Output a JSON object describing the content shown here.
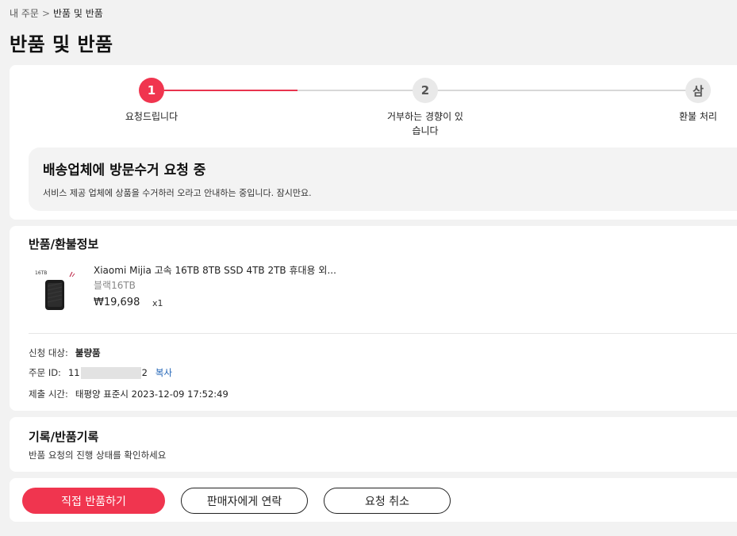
{
  "breadcrumb": {
    "parent": "내 주문",
    "separator": ">",
    "current": "반품 및 반품"
  },
  "page_title": "반품 및 반품",
  "steps": [
    {
      "number": "1",
      "label": "요청드립니다",
      "state": "active"
    },
    {
      "number": "2",
      "label_line1": "거부하는 경향이 있",
      "label_line2": "습니다",
      "state": "inactive"
    },
    {
      "number": "삼",
      "label": "환불 처리",
      "state": "inactive"
    }
  ],
  "notice": {
    "title": "배송업체에 방문수거 요청 중",
    "description": "서비스 제공 업체에 상품을 수거하러 오라고 안내하는 중입니다. 잠시만요."
  },
  "return_info": {
    "title": "반품/환불정보",
    "product": {
      "image_text": "16TB",
      "name": "Xiaomi Mijia 고속 16TB 8TB SSD 4TB 2TB 휴대용 외...",
      "variant": "블랙16TB",
      "price": "₩19,698",
      "quantity": "x1"
    },
    "request_target_label": "신청 대상:",
    "request_target_value": "불량품",
    "order_id_label": "주문 ID:",
    "order_id_prefix": "11",
    "order_id_suffix": "2",
    "copy_label": "복사",
    "submit_time_label": "제출 시간:",
    "submit_time_value": "태평양 표준시 2023-12-09 17:52:49"
  },
  "history": {
    "title": "기록/반품기록",
    "description": "반품 요청의 진행 상태를 확인하세요"
  },
  "actions": {
    "primary": "직접 반품하기",
    "contact": "판매자에게 연락",
    "cancel": "요청 취소"
  },
  "colors": {
    "accent": "#f0354f",
    "link": "#1a5fb4"
  }
}
